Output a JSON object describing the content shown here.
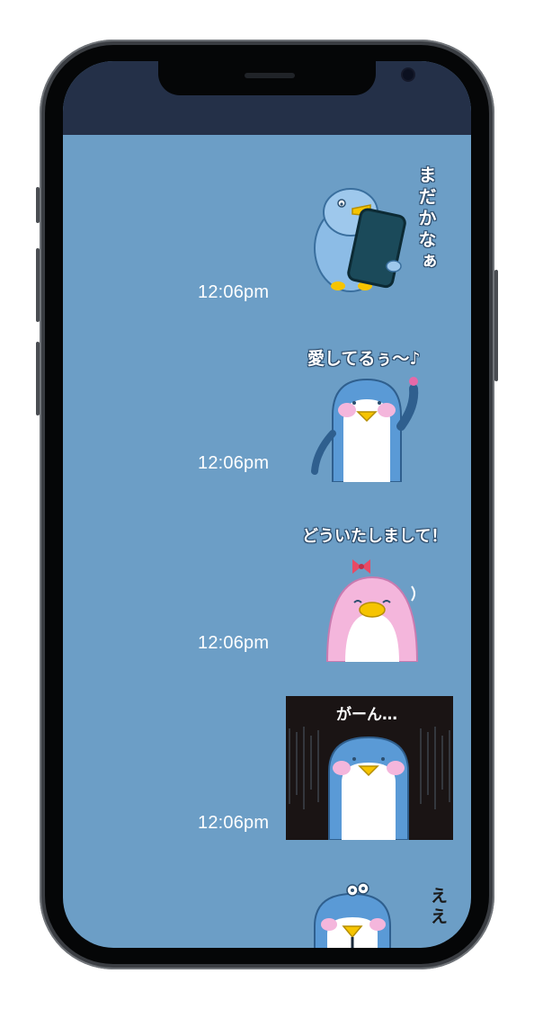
{
  "chat": {
    "messages": [
      {
        "time": "12:06pm",
        "sticker_text": "まだかなぁ",
        "sticker": "penguin-phone-sticker"
      },
      {
        "time": "12:06pm",
        "sticker_text": "愛してるぅ〜♪",
        "sticker": "penguin-waving-flower-sticker"
      },
      {
        "time": "12:06pm",
        "sticker_text": "どういたしまして！",
        "sticker": "pink-penguin-bow-sticker"
      },
      {
        "time": "12:06pm",
        "sticker_text": "がーん…",
        "sticker": "penguin-shocked-sticker"
      },
      {
        "time": "",
        "sticker_text": "ええ",
        "sticker": "penguin-surprised-sticker"
      }
    ]
  },
  "colors": {
    "chat_background": "#6c9ec6",
    "status_bar": "#243048",
    "penguin_blue": "#5a9ad6",
    "penguin_pink": "#f4b6dc"
  }
}
